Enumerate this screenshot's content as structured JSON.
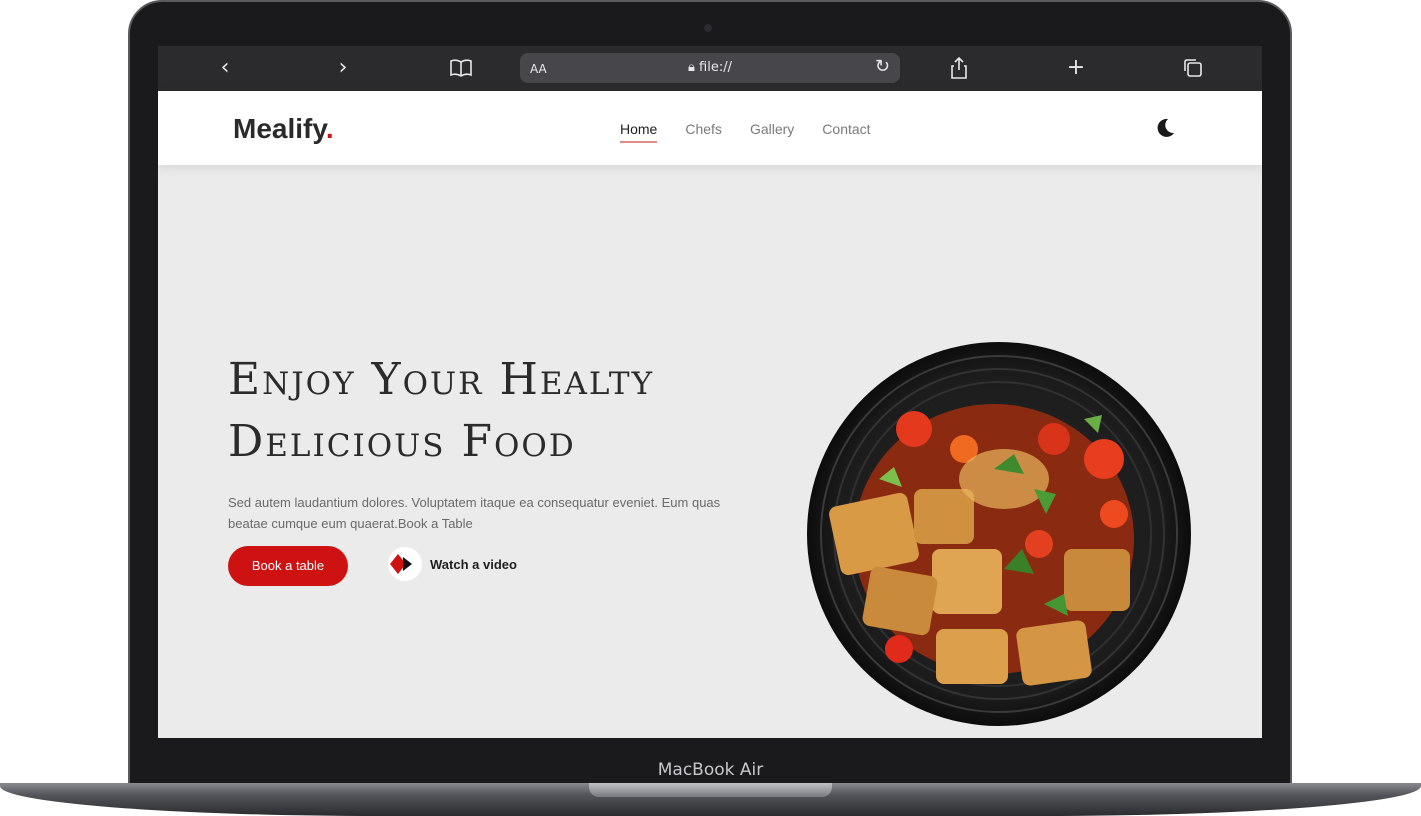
{
  "device": {
    "label": "MacBook Air"
  },
  "browser": {
    "text_size_label": "AA",
    "url": "file://"
  },
  "site": {
    "logo": "Mealify",
    "logo_dot": ".",
    "nav": [
      "Home",
      "Chefs",
      "Gallery",
      "Contact"
    ],
    "active_nav": "Home",
    "hero": {
      "title_line1": "Enjoy Your Healty",
      "title_line2": "Delicious Food",
      "text": "Sed autem laudantium dolores. Voluptatem itaque ea consequatur eveniet. Eum quas beatae cumque eum quaerat.Book a Table",
      "book_button": "Book a table",
      "video_link": "Watch a video"
    }
  },
  "colors": {
    "accent": "#ce1212",
    "page_bg": "#ebebeb"
  },
  "icons": [
    "back-icon",
    "forward-icon",
    "bookmarks-icon",
    "lock-icon",
    "reload-icon",
    "share-icon",
    "new-tab-icon",
    "tabs-icon",
    "moon-icon",
    "play-icon"
  ]
}
